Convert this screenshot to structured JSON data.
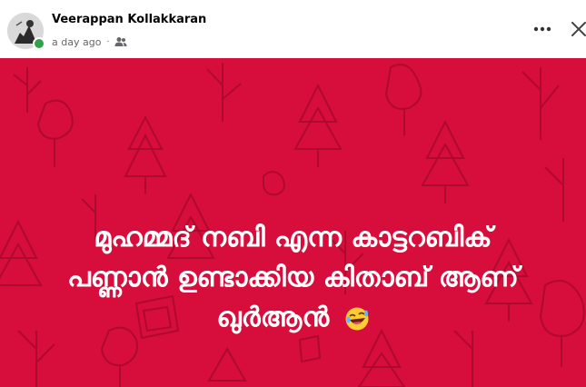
{
  "post": {
    "author": "Veerappan Kollakkaran",
    "timestamp": "a day ago",
    "separator": "·",
    "audience_icon": "friends-icon",
    "text_lines": [
      "മുഹമ്മദ് നബി എന്ന കാട്ടറബിക്",
      "പണ്ണാൻ ഉണ്ടാക്കിയ കിതാബ് ആണ്",
      "ഖുർആൻ"
    ],
    "emoji": "rolling-on-floor-laughing-emoji",
    "background_color": "#d70d3b"
  },
  "controls": {
    "more_icon": "more-options-icon",
    "close_icon": "close-icon"
  }
}
